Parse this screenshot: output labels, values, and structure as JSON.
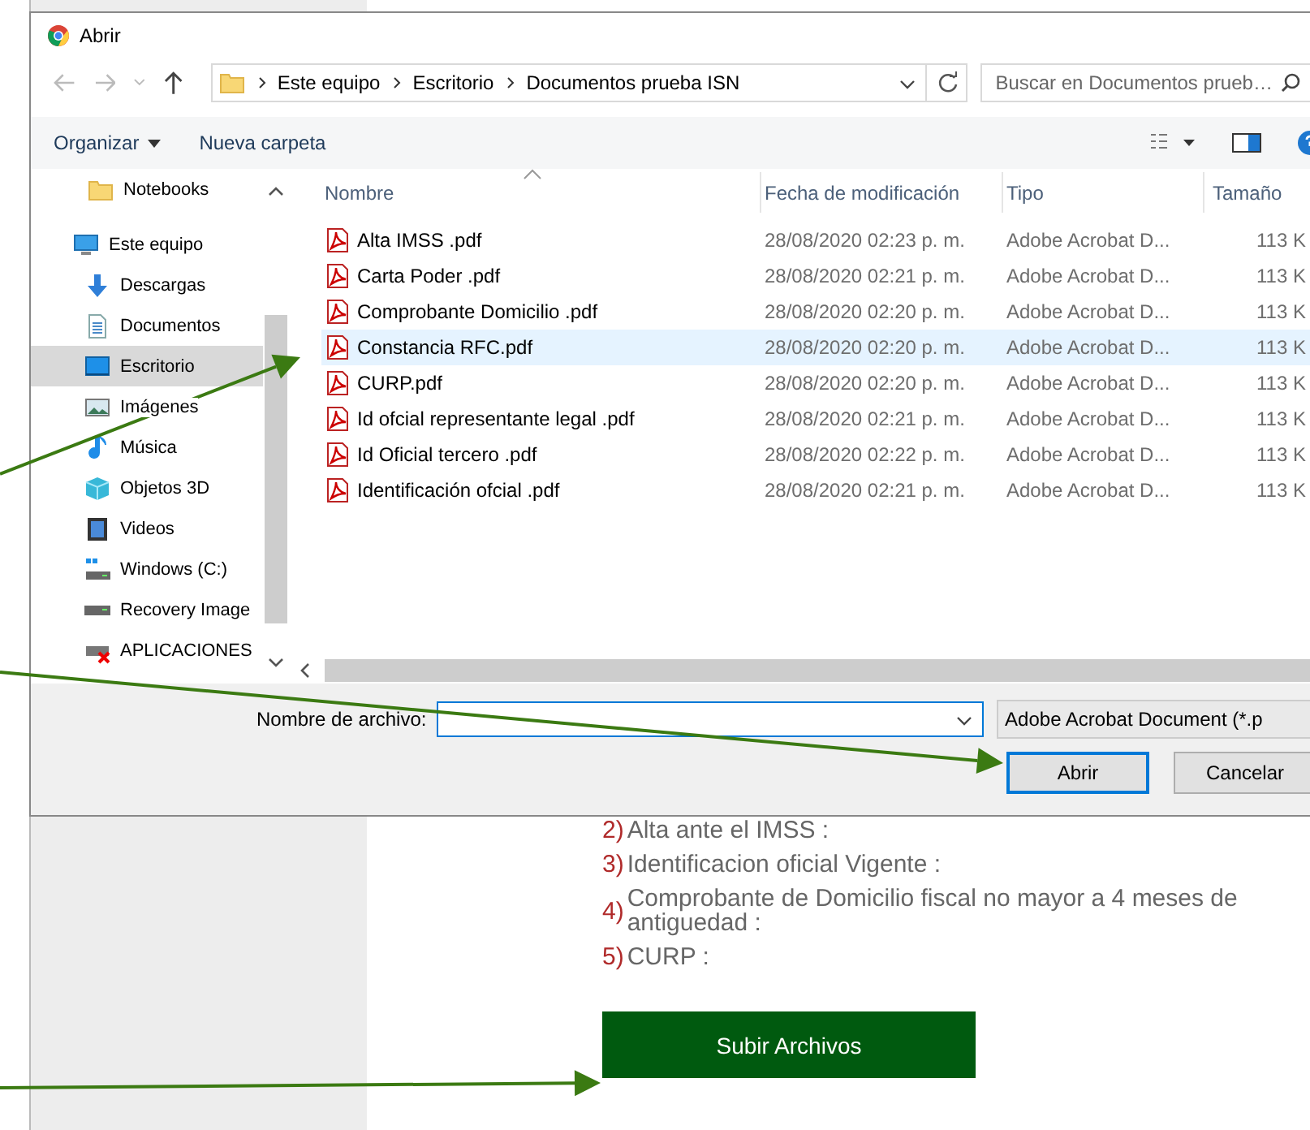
{
  "window": {
    "title": "Abrir"
  },
  "address": {
    "path": [
      "Este equipo",
      "Escritorio",
      "Documentos prueba ISN"
    ]
  },
  "search": {
    "placeholder": "Buscar en Documentos prueb…"
  },
  "toolbar": {
    "items": [
      {
        "label": "Organizar",
        "kind": "menu"
      },
      {
        "label": "Nueva carpeta",
        "kind": "button"
      }
    ]
  },
  "nav": {
    "items": [
      {
        "label": "Notebooks",
        "kind": "folder",
        "selected": false
      },
      {
        "label": "Este equipo",
        "kind": "computer",
        "selected": false,
        "children": [
          {
            "label": "Descargas",
            "kind": "download",
            "selected": false
          },
          {
            "label": "Documentos",
            "kind": "document",
            "selected": false
          },
          {
            "label": "Escritorio",
            "kind": "desktop",
            "selected": true
          },
          {
            "label": "Imágenes",
            "kind": "pictures",
            "selected": false
          },
          {
            "label": "Música",
            "kind": "music",
            "selected": false
          },
          {
            "label": "Objetos 3D",
            "kind": "cube",
            "selected": false
          },
          {
            "label": "Videos",
            "kind": "video",
            "selected": false
          },
          {
            "label": "Windows (C:)",
            "kind": "windrive",
            "selected": false
          },
          {
            "label": "Recovery Image",
            "kind": "drive",
            "selected": false
          },
          {
            "label": "APLICACIONES",
            "kind": "netdrive",
            "selected": false
          }
        ]
      }
    ]
  },
  "files": {
    "columns": [
      "Nombre",
      "Fecha de modificación",
      "Tipo",
      "Tamaño"
    ],
    "rows": [
      {
        "name": "Alta IMSS .pdf",
        "modified": "28/08/2020 02:23 p. m.",
        "type": "Adobe Acrobat D...",
        "size": "113 K",
        "selected": false
      },
      {
        "name": "Carta Poder .pdf",
        "modified": "28/08/2020 02:21 p. m.",
        "type": "Adobe Acrobat D...",
        "size": "113 K",
        "selected": false
      },
      {
        "name": "Comprobante Domicilio .pdf",
        "modified": "28/08/2020 02:20 p. m.",
        "type": "Adobe Acrobat D...",
        "size": "113 K",
        "selected": false
      },
      {
        "name": "Constancia RFC.pdf",
        "modified": "28/08/2020 02:20 p. m.",
        "type": "Adobe Acrobat D...",
        "size": "113 K",
        "selected": true
      },
      {
        "name": "CURP.pdf",
        "modified": "28/08/2020 02:20 p. m.",
        "type": "Adobe Acrobat D...",
        "size": "113 K",
        "selected": false
      },
      {
        "name": "Id ofcial representante legal .pdf",
        "modified": "28/08/2020 02:21 p. m.",
        "type": "Adobe Acrobat D...",
        "size": "113 K",
        "selected": false
      },
      {
        "name": "Id Oficial tercero .pdf",
        "modified": "28/08/2020 02:22 p. m.",
        "type": "Adobe Acrobat D...",
        "size": "113 K",
        "selected": false
      },
      {
        "name": "Identificación ofcial .pdf",
        "modified": "28/08/2020 02:21 p. m.",
        "type": "Adobe Acrobat D...",
        "size": "113 K",
        "selected": false
      }
    ]
  },
  "file_name": {
    "label": "Nombre de archivo:"
  },
  "filter": {
    "value": "Adobe Acrobat Document (*.p"
  },
  "buttons": [
    {
      "label": "Abrir",
      "default": true
    },
    {
      "label": "Cancelar",
      "default": false
    }
  ],
  "page": {
    "requirements": [
      {
        "number": "2)",
        "text": "Alta ante el IMSS :"
      },
      {
        "number": "3)",
        "text": "Identificacion oficial Vigente :"
      },
      {
        "number": "4)",
        "text": "Comprobante de Domicilio fiscal no mayor a 4 meses de antiguedad :"
      },
      {
        "number": "5)",
        "text": "CURP :"
      }
    ],
    "upload_button": "Subir Archivos"
  }
}
